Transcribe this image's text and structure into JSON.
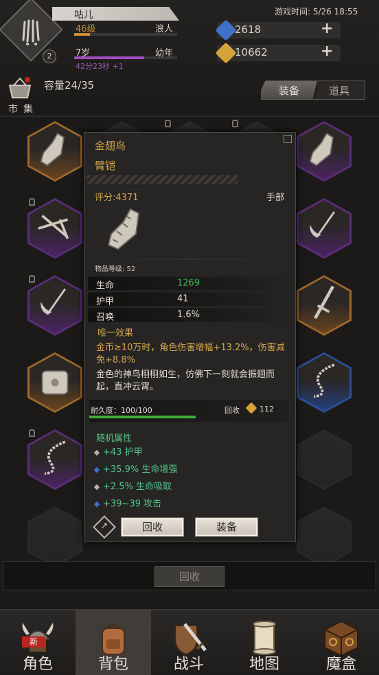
{
  "player": {
    "emblem_icon": "claw-emblem-icon",
    "emblem_badge": "2",
    "name": "咕儿",
    "level": "46级",
    "class": "浪人",
    "xp_fraction": 0.15,
    "age": "7岁",
    "life_stage": "幼年",
    "age_fraction": 0.68,
    "timer": "42分23秒 +1"
  },
  "game_time": "游戏时间: 5/26 18:55",
  "currencies": [
    {
      "name": "gem",
      "value": "2618",
      "color": "#3f71c8"
    },
    {
      "name": "gold",
      "value": "10662",
      "color": "#d6a33a"
    }
  ],
  "shop_label": "市集",
  "capacity": "容量24/35",
  "tabs": {
    "equip": "装备",
    "items": "道具"
  },
  "inventory": [
    {
      "icon": "armguard-icon",
      "rarity": "orange"
    },
    {
      "icon": "armguard-icon",
      "rarity": "purple"
    },
    {
      "icon": "crossbow-icon",
      "rarity": "purple"
    },
    {
      "icon": "scythe-icon",
      "rarity": "purple"
    },
    {
      "icon": "scythe-icon",
      "rarity": "purple"
    },
    {
      "icon": "sword-icon",
      "rarity": "orange"
    },
    {
      "icon": "chest-armor-icon",
      "rarity": "orange"
    },
    {
      "icon": "chain-whip-icon",
      "rarity": "blue"
    },
    {
      "icon": "chain-whip-icon",
      "rarity": "purple"
    }
  ],
  "tooltip": {
    "name": "金翅鸟",
    "type": "臂铠",
    "score": "评分:4371",
    "slot": "手部",
    "item_level": "物品等级: 52",
    "stats": [
      {
        "name": "生命",
        "value": "1269",
        "color": "#3fbf5a"
      },
      {
        "name": "护甲",
        "value": "41",
        "color": "#e0dad0"
      },
      {
        "name": "召唤",
        "value": "1.6%",
        "color": "#e0dad0"
      }
    ],
    "unique_title": "唯一效果",
    "unique_effect": "金币≥10万时，角色伤害增幅+13.2%，伤害减免+8.8%",
    "flavor": "金色的神鸟栩栩如生，仿佛下一刻就会振翅而起，直冲云霄。",
    "durability_label": "耐久度：100/100",
    "durability_fraction": 1.0,
    "recycle_label": "回收",
    "recycle_value": "112",
    "random_title": "随机属性",
    "affixes": [
      {
        "text": "+43 护甲",
        "dot_color": "#b8b2a8"
      },
      {
        "text": "+35.9% 生命增强",
        "dot_color": "#3f71c8"
      },
      {
        "text": "+2.5% 生命吸取",
        "dot_color": "#b8b2a8"
      },
      {
        "text": "+39~39 攻击",
        "dot_color": "#3f71c8"
      }
    ],
    "share_icon": "share-icon",
    "btn_recycle": "回收",
    "btn_equip": "装备"
  },
  "bottom_recycle": "回收",
  "nav": [
    {
      "label": "角色",
      "icon": "viking-helmet-icon",
      "badge": "新",
      "active": false
    },
    {
      "label": "背包",
      "icon": "backpack-icon",
      "badge": "",
      "active": true
    },
    {
      "label": "战斗",
      "icon": "sword-shield-icon",
      "badge": "",
      "active": false
    },
    {
      "label": "地图",
      "icon": "scroll-map-icon",
      "badge": "",
      "active": false
    },
    {
      "label": "魔盒",
      "icon": "magic-box-icon",
      "badge": "",
      "active": false
    }
  ]
}
